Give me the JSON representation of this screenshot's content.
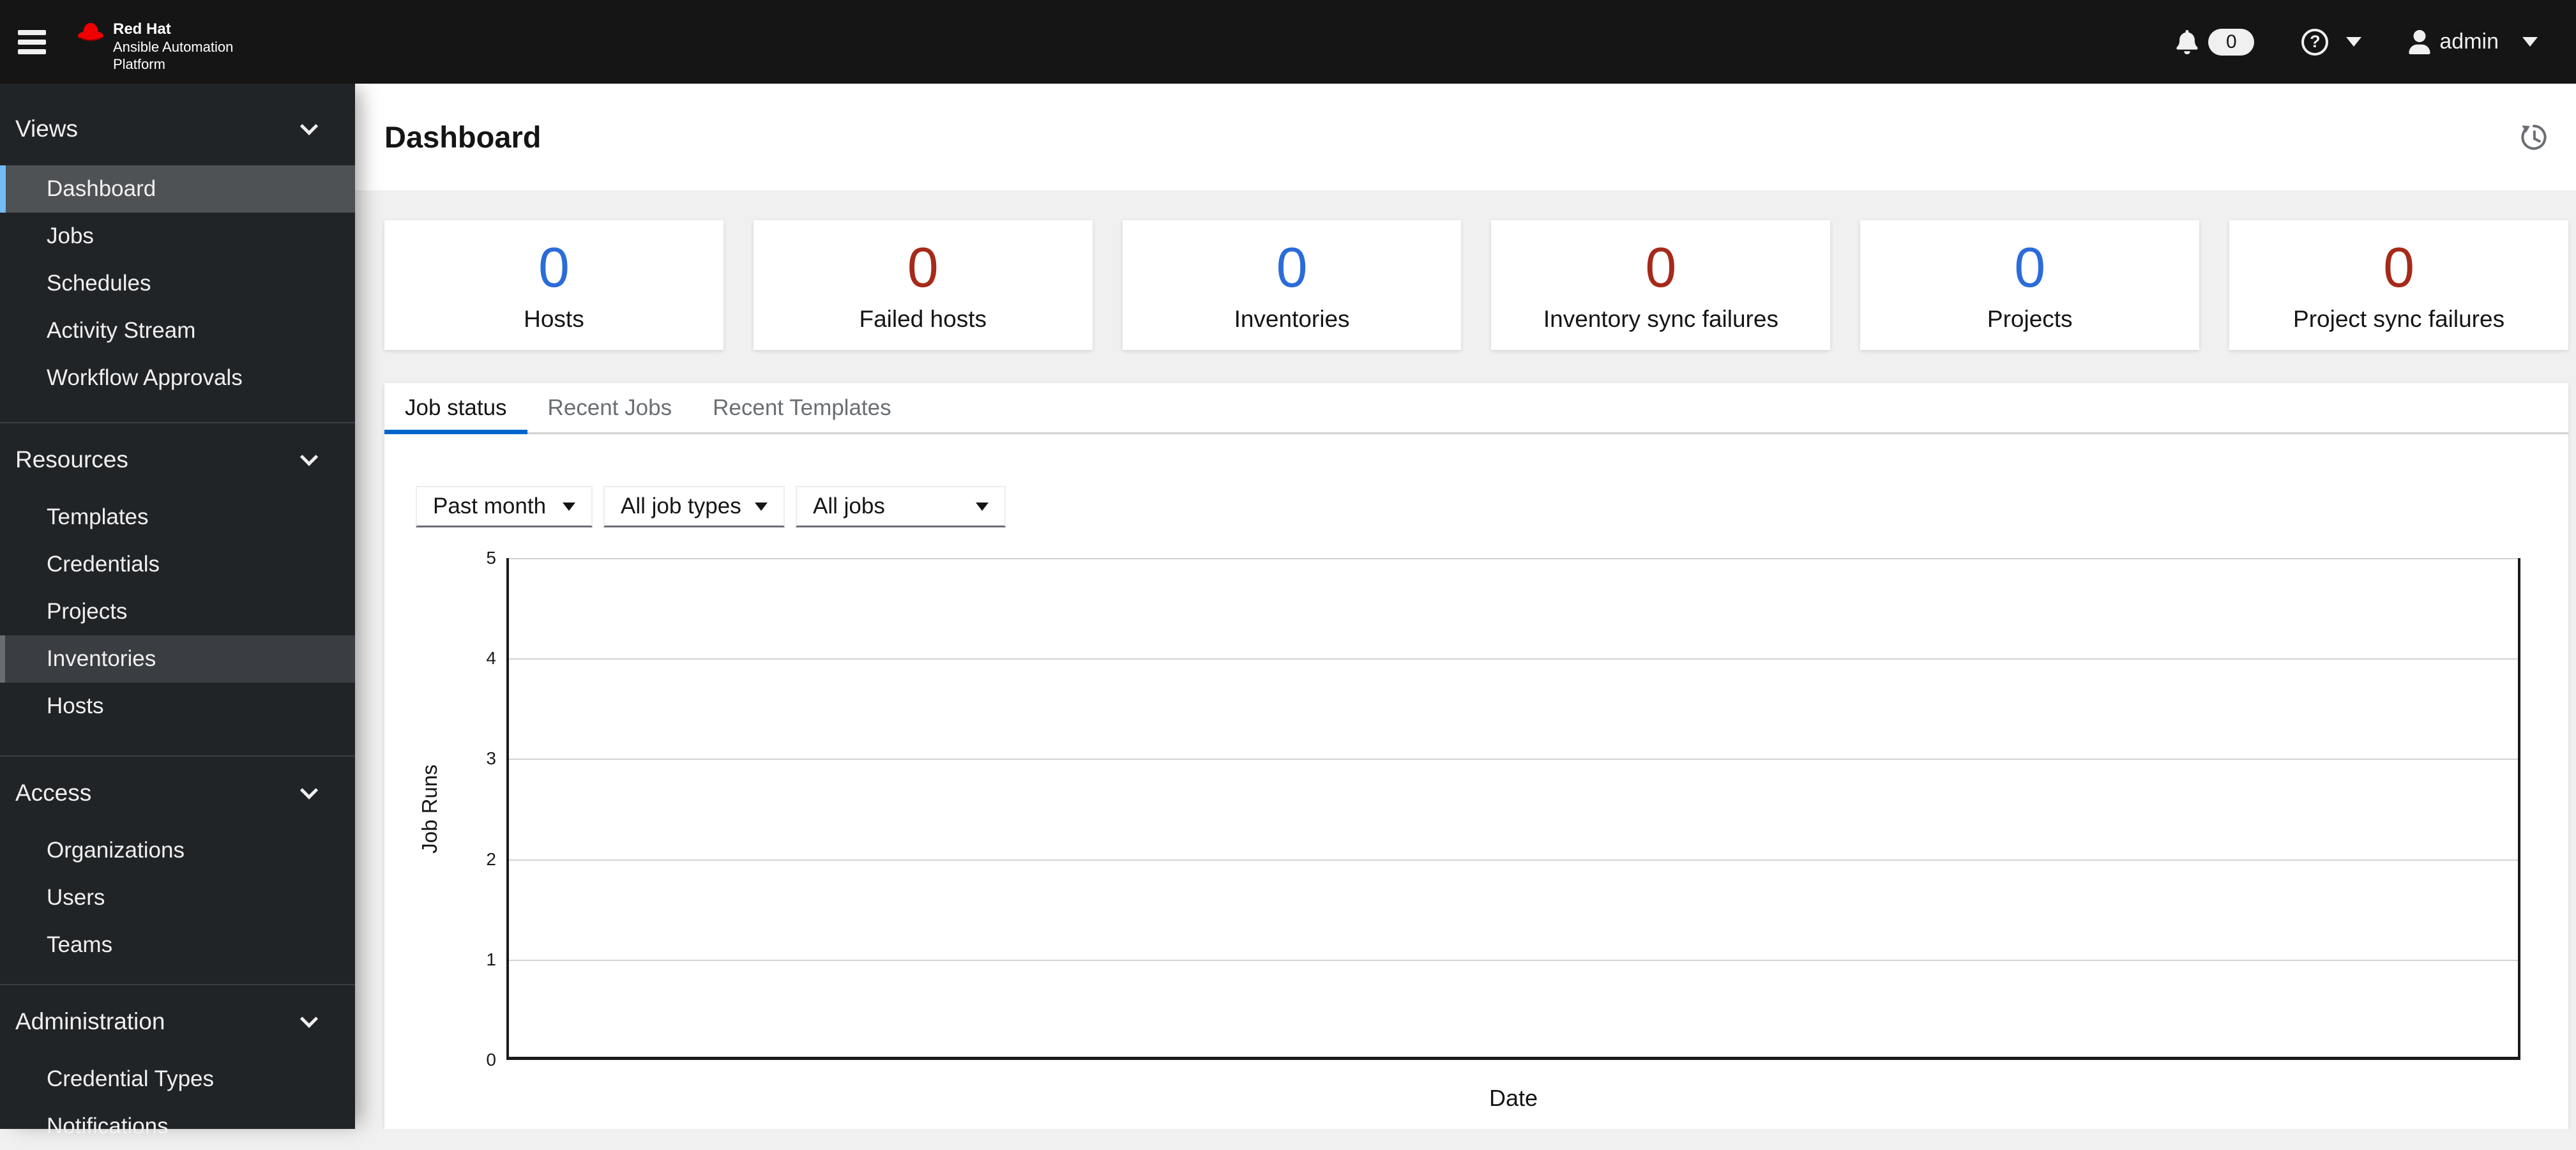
{
  "masthead": {
    "brand": {
      "line1": "Red Hat",
      "line2": "Ansible Automation",
      "line3": "Platform"
    },
    "notifications_count": "0",
    "user": "admin"
  },
  "sidebar": {
    "sections": [
      {
        "label": "Views",
        "items": [
          {
            "label": "Dashboard",
            "state": "current"
          },
          {
            "label": "Jobs"
          },
          {
            "label": "Schedules"
          },
          {
            "label": "Activity Stream"
          },
          {
            "label": "Workflow Approvals"
          }
        ]
      },
      {
        "label": "Resources",
        "items": [
          {
            "label": "Templates"
          },
          {
            "label": "Credentials"
          },
          {
            "label": "Projects"
          },
          {
            "label": "Inventories",
            "state": "hovered"
          },
          {
            "label": "Hosts"
          }
        ]
      },
      {
        "label": "Access",
        "items": [
          {
            "label": "Organizations"
          },
          {
            "label": "Users"
          },
          {
            "label": "Teams"
          }
        ]
      },
      {
        "label": "Administration",
        "items": [
          {
            "label": "Credential Types"
          },
          {
            "label": "Notifications"
          }
        ]
      }
    ]
  },
  "page": {
    "title": "Dashboard"
  },
  "cards": [
    {
      "value": "0",
      "label": "Hosts",
      "color": "#2b6cd8"
    },
    {
      "value": "0",
      "label": "Failed hosts",
      "color": "#a52a1a"
    },
    {
      "value": "0",
      "label": "Inventories",
      "color": "#2b6cd8"
    },
    {
      "value": "0",
      "label": "Inventory sync failures",
      "color": "#a52a1a"
    },
    {
      "value": "0",
      "label": "Projects",
      "color": "#2b6cd8"
    },
    {
      "value": "0",
      "label": "Project sync failures",
      "color": "#a52a1a"
    }
  ],
  "tabs": [
    {
      "label": "Job status",
      "active": true
    },
    {
      "label": "Recent Jobs",
      "active": false
    },
    {
      "label": "Recent Templates",
      "active": false
    }
  ],
  "filters": [
    {
      "value": "Past month"
    },
    {
      "value": "All job types"
    },
    {
      "value": "All jobs"
    }
  ],
  "chart_data": {
    "type": "line",
    "title": "Job status",
    "xlabel": "Date",
    "ylabel": "Job Runs",
    "ylim": [
      0,
      5
    ],
    "yticks": [
      5,
      4,
      3,
      2,
      1,
      0
    ],
    "ytick_labels": [
      "5",
      "4",
      "3",
      "2",
      "1",
      "0"
    ],
    "x": [],
    "series": [],
    "grid": true,
    "legend": false
  },
  "colors": {
    "masthead_bg": "#151515",
    "sidebar_bg": "#212427",
    "content_bg": "#f0f0f0",
    "brand_red": "#ee0000",
    "nav_current_indicator": "#73bcf7",
    "tab_underline": "#0066cc",
    "count_blue": "#2b6cd8",
    "count_red": "#a52a1a"
  },
  "icons": {
    "menu": "hamburger-icon",
    "notifications": "bell-icon",
    "help": "question-circle-icon",
    "user": "user-icon",
    "history": "history-icon",
    "caret": "caret-down-icon",
    "section_chevron": "chevron-down-icon"
  }
}
